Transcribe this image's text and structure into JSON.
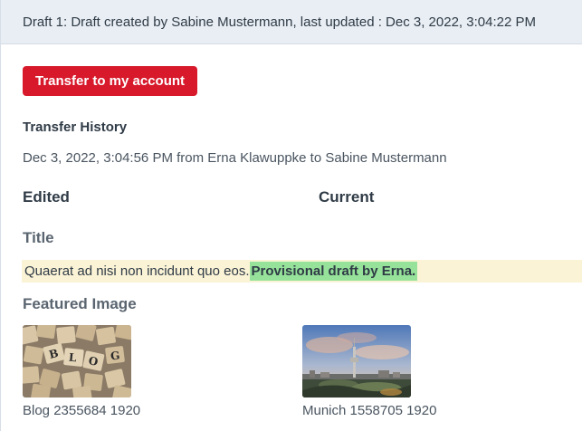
{
  "header": {
    "title": "Draft 1: Draft created by Sabine Mustermann, last updated : Dec 3, 2022, 3:04:22 PM"
  },
  "actions": {
    "transfer_label": "Transfer to my account"
  },
  "transfer_history": {
    "heading": "Transfer History",
    "entry": "Dec 3, 2022, 3:04:56 PM from Erna Klawuppke to Sabine Mustermann"
  },
  "compare": {
    "edited_label": "Edited",
    "current_label": "Current"
  },
  "fields": {
    "title_label": "Title",
    "title_unchanged": "Quaerat ad nisi non incidunt quo eos.",
    "title_added": "Provisional draft by Erna.",
    "featured_image_label": "Featured Image"
  },
  "images": {
    "edited_caption": "Blog 2355684 1920",
    "current_caption": "Munich 1558705 1920"
  },
  "colors": {
    "accent_button": "#d7192b",
    "diff_background": "#fbf3d6",
    "diff_added": "#96e29a",
    "header_background": "#e9eef4"
  }
}
